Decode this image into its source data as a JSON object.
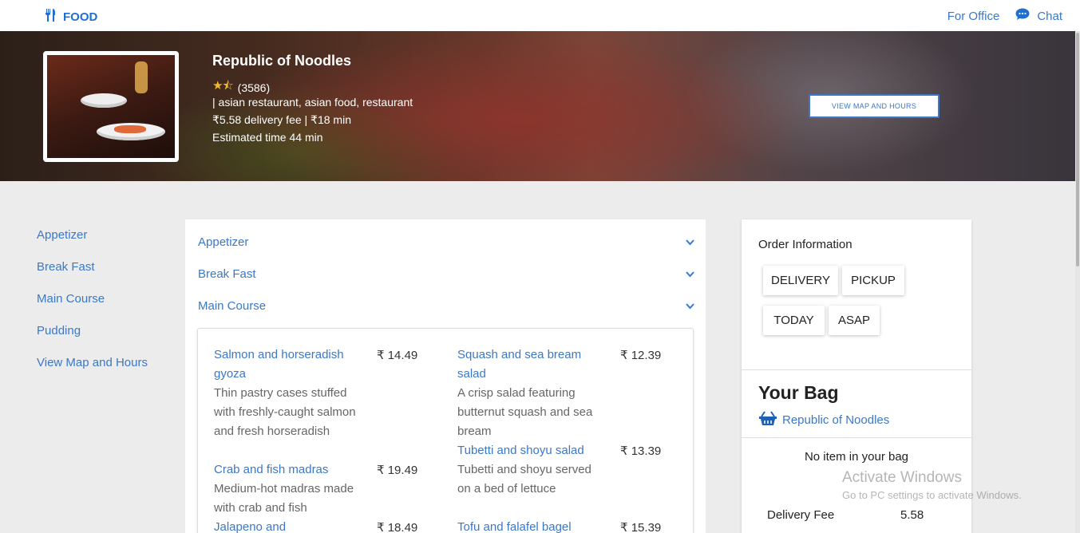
{
  "nav": {
    "brand": "FOOD",
    "for_office": "For Office",
    "chat": "Chat"
  },
  "hero": {
    "name": "Republic of Noodles",
    "rating_count": "(3586)",
    "categories": "| asian restaurant, asian food, restaurant",
    "fees": "₹5.58 delivery fee | ₹18 min",
    "estimated": "Estimated time 44 min",
    "view_map_button": "VIEW MAP AND HOURS"
  },
  "left_nav": [
    "Appetizer",
    "Break Fast",
    "Main Course",
    "Pudding",
    "View Map and Hours"
  ],
  "menu": {
    "categories": [
      "Appetizer",
      "Break Fast",
      "Main Course"
    ],
    "items": [
      {
        "name": "Salmon and horseradish gyoza",
        "price": "₹ 14.49",
        "desc": "Thin pastry cases stuffed with freshly-caught salmon and fresh horseradish"
      },
      {
        "name": "Squash and sea bream salad",
        "price": "₹ 12.39",
        "desc": "A crisp salad featuring butternut squash and sea bream"
      },
      {
        "name": "Crab and fish madras",
        "price": "₹ 19.49",
        "desc": "Medium-hot madras made with crab and fish"
      },
      {
        "name": "Tubetti and shoyu salad",
        "price": "₹ 13.39",
        "desc": "Tubetti and shoyu served on a bed of lettuce"
      },
      {
        "name": "Jalapeno and",
        "price": "₹ 18.49"
      },
      {
        "name": "Tofu and falafel bagel",
        "price": "₹ 15.39"
      }
    ]
  },
  "order": {
    "title": "Order Information",
    "delivery": "DELIVERY",
    "pickup": "PICKUP",
    "today": "TODAY",
    "asap": "ASAP",
    "bag_title": "Your Bag",
    "bag_restaurant": "Republic of Noodles",
    "empty": "No item in your bag",
    "fee_label": "Delivery Fee",
    "fee_value": "5.58"
  },
  "watermark": {
    "title": "Activate Windows",
    "subtitle": "Go to PC settings to activate Windows."
  }
}
